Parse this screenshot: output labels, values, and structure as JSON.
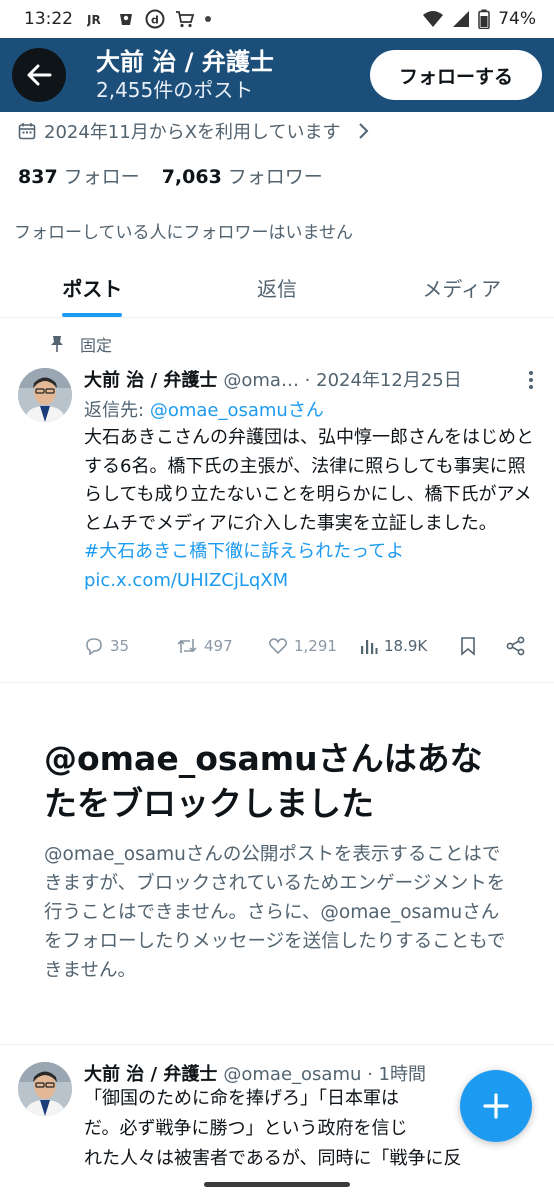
{
  "status_bar": {
    "time": "13:22",
    "battery": "74%",
    "icons": [
      "jr-icon",
      "app-icon",
      "docomo-icon",
      "cart-icon",
      "dot-icon",
      "wifi-icon",
      "signal-icon",
      "battery-icon"
    ]
  },
  "header": {
    "name": "大前 治 / 弁護士",
    "post_count": "2,455件のポスト",
    "follow_label": "フォローする",
    "colors": {
      "banner": "#1b4f7a",
      "back_button": "#0f1419"
    }
  },
  "profile": {
    "joined": "2024年11月からXを利用しています",
    "following_count": "837",
    "following_label": "フォロー",
    "followers_count": "7,063",
    "followers_label": "フォロワー",
    "mutual_note": "フォローしている人にフォロワーはいません"
  },
  "tabs": [
    {
      "label": "ポスト",
      "active": true
    },
    {
      "label": "返信",
      "active": false
    },
    {
      "label": "メディア",
      "active": false
    }
  ],
  "pinned_post": {
    "pinned_label": "固定",
    "author_name": "大前 治 / 弁護士",
    "meta": "@oma… · 2024年12月25日",
    "reply_prefix": "返信先:",
    "reply_handle": "@omae_osamuさん",
    "body": "大石あきこさんの弁護団は、弘中惇一郎さんをはじめとする6名。橋下氏の主張が、法律に照らしても事実に照らしても成り立たないことを明らかにし、橋下氏がアメとムチでメディアに介入した事実を立証しました。",
    "hashtag": "#大石あきこ橋下徹に訴えられたってよ",
    "link": "pic.x.com/UHIZCjLqXM",
    "replies": "35",
    "reposts": "497",
    "likes": "1,291",
    "views": "18.9K"
  },
  "block_notice": {
    "title": "@omae_osamuさんはあなたをブロックしました",
    "description": "@omae_osamuさんの公開ポストを表示することはできますが、ブロックされているためエンゲージメントを行うことはできません。さらに、@omae_osamuさんをフォローしたりメッセージを送信したりすることもできません。"
  },
  "second_post": {
    "author_name": "大前 治 / 弁護士",
    "meta": "@omae_osamu · 1時間",
    "body_lines": [
      "「御国のために命を捧げろ」「日本軍は",
      "だ。必ず戦争に勝つ」という政府を信じ",
      "れた人々は被害者であるが、同時に「戦争に反"
    ]
  },
  "colors": {
    "accent": "#1d9bf0",
    "secondary_text": "#536471"
  }
}
